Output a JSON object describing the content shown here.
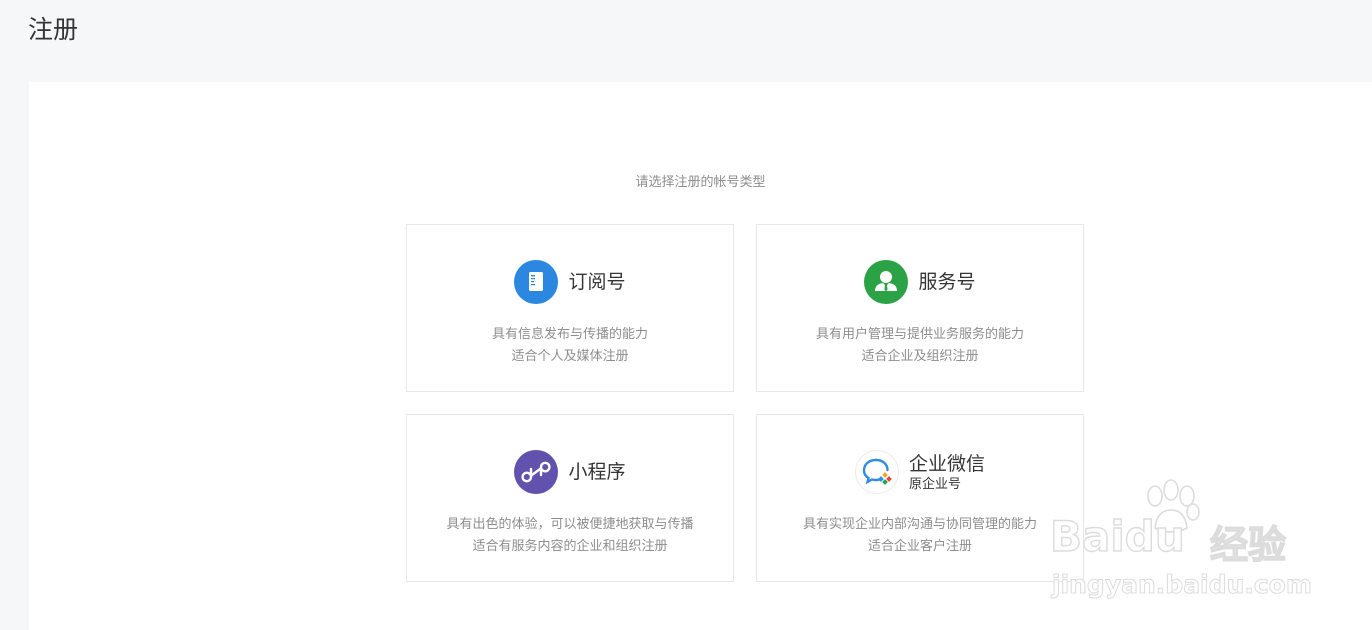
{
  "page": {
    "title": "注册"
  },
  "panel": {
    "subtitle": "请选择注册的帐号类型"
  },
  "cards": [
    {
      "name": "订阅号",
      "subname": "",
      "desc_line1": "具有信息发布与传播的能力",
      "desc_line2": "适合个人及媒体注册",
      "icon": "document-icon",
      "color": "#2b87df"
    },
    {
      "name": "服务号",
      "subname": "",
      "desc_line1": "具有用户管理与提供业务服务的能力",
      "desc_line2": "适合企业及组织注册",
      "icon": "person-icon",
      "color": "#2ba245"
    },
    {
      "name": "小程序",
      "subname": "",
      "desc_line1": "具有出色的体验，可以被便捷地获取与传播",
      "desc_line2": "适合有服务内容的企业和组织注册",
      "icon": "mini-program-icon",
      "color": "#6252ad"
    },
    {
      "name": "企业微信",
      "subname": "原企业号",
      "desc_line1": "具有实现企业内部沟通与协同管理的能力",
      "desc_line2": "适合企业客户注册",
      "icon": "wecom-icon",
      "color": "#2f8ce6"
    }
  ],
  "watermark": {
    "brand": "Baidu",
    "suffix": "经验",
    "url": "jingyan.baidu.com"
  }
}
